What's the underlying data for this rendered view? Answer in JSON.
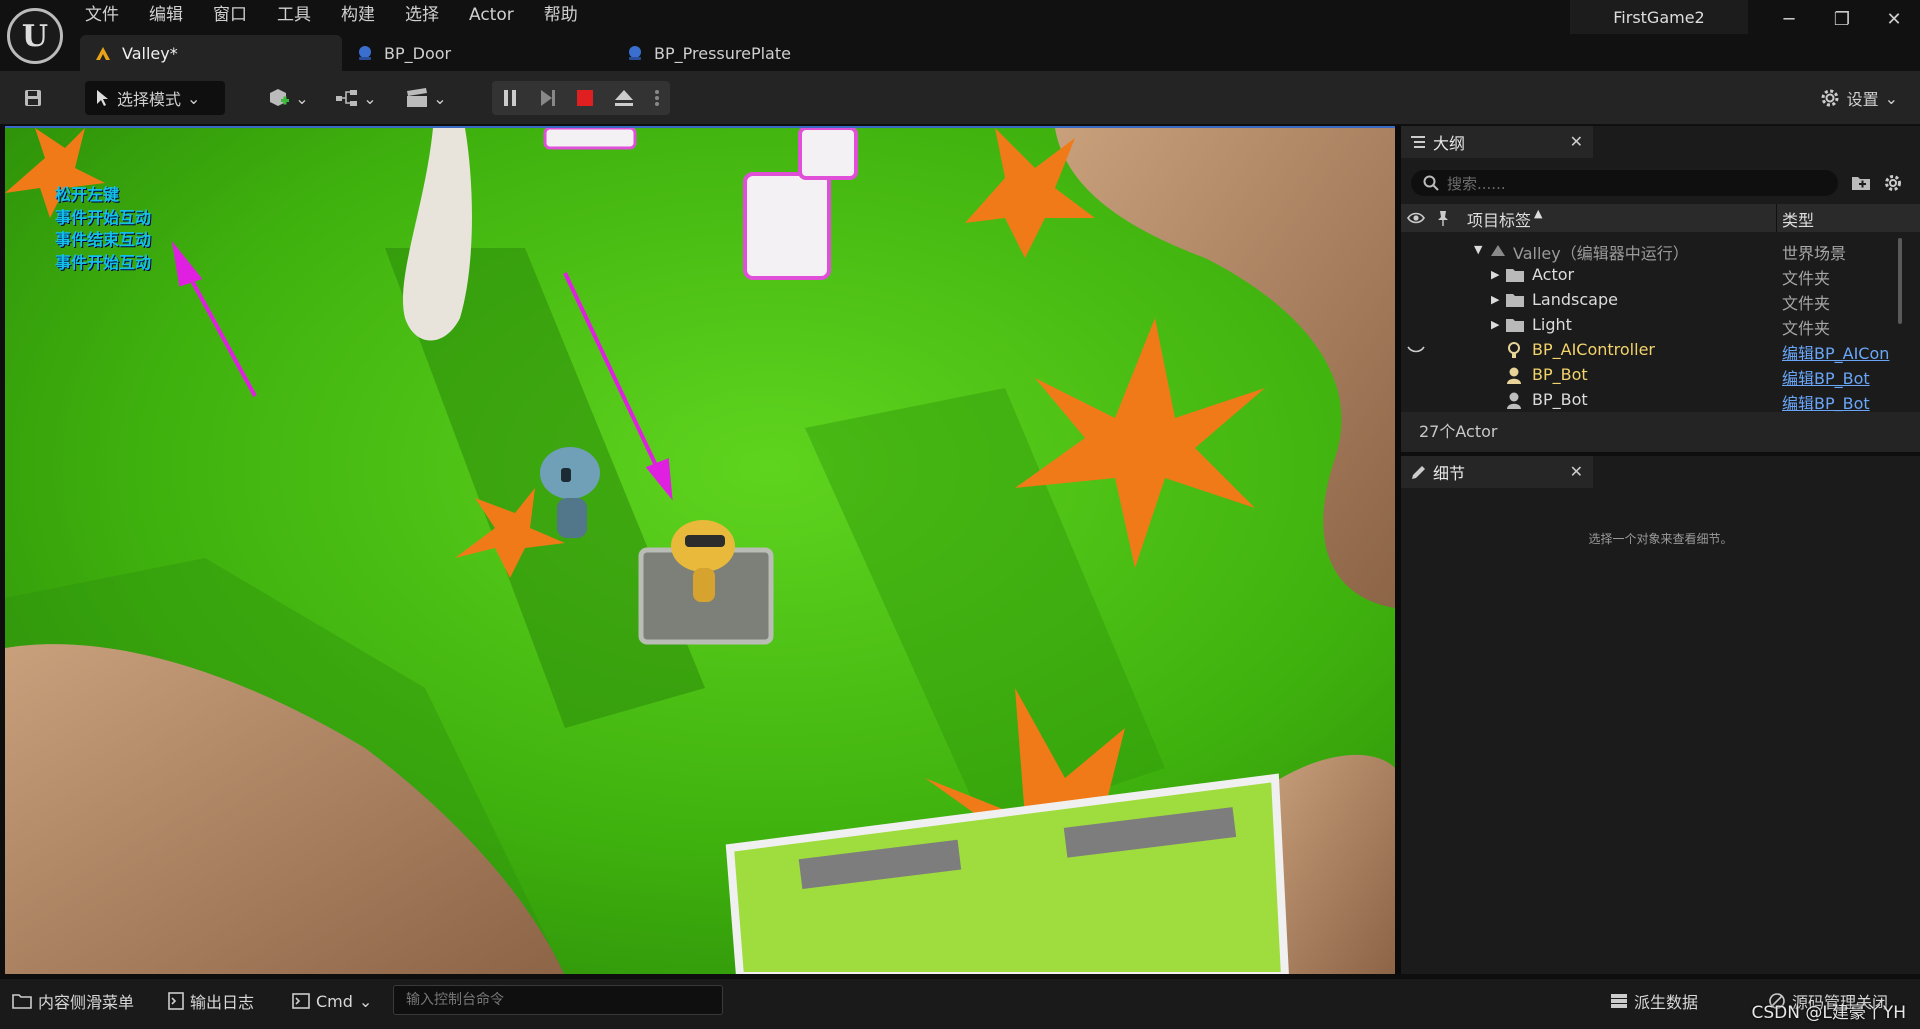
{
  "menu": [
    "文件",
    "编辑",
    "窗口",
    "工具",
    "构建",
    "选择",
    "Actor",
    "帮助"
  ],
  "tabs": [
    {
      "label": "Valley*",
      "active": true
    },
    {
      "label": "BP_Door",
      "active": false
    },
    {
      "label": "BP_PressurePlate",
      "active": false
    }
  ],
  "project_name": "FirstGame2",
  "window_controls": {
    "minimize": "─",
    "restore": "❐",
    "close": "✕"
  },
  "toolbar": {
    "mode_label": "选择模式",
    "settings_label": "设置"
  },
  "viewport": {
    "debug_messages": [
      "松开左键",
      "事件开始互动",
      "事件结束互动",
      "事件开始互动"
    ]
  },
  "outliner": {
    "title": "大纲",
    "search_placeholder": "搜索......",
    "columns": {
      "label": "项目标签",
      "type": "类型"
    },
    "rows": [
      {
        "label": "Valley（编辑器中运行）",
        "type": "世界场景",
        "kind": "world",
        "link": false
      },
      {
        "label": "Actor",
        "type": "文件夹",
        "kind": "folder",
        "link": false
      },
      {
        "label": "Landscape",
        "type": "文件夹",
        "kind": "folder",
        "link": false
      },
      {
        "label": "Light",
        "type": "文件夹",
        "kind": "folder",
        "link": false
      },
      {
        "label": "BP_AIController",
        "type": "编辑BP_AICon",
        "kind": "actor",
        "link": true
      },
      {
        "label": "BP_Bot",
        "type": "编辑BP_Bot",
        "kind": "actor",
        "link": true
      },
      {
        "label": "BP_Bot",
        "type": "编辑BP_Bot",
        "kind": "actor",
        "link": true
      }
    ],
    "actor_count": "27个Actor"
  },
  "details": {
    "title": "细节",
    "empty_message": "选择一个对象来查看细节。"
  },
  "statusbar": {
    "content_drawer": "内容侧滑菜单",
    "output_log": "输出日志",
    "cmd": "Cmd",
    "console_placeholder": "输入控制台命令",
    "derived_data": "派生数据",
    "source_control": "源码管理关闭"
  },
  "watermark": "CSDN @L建豪丫YH",
  "colors": {
    "accent": "#3b6cc5",
    "debug_text": "#13c0e8",
    "arrow": "#e020e0",
    "link": "#6aa6f8",
    "stop": "#e02020"
  }
}
